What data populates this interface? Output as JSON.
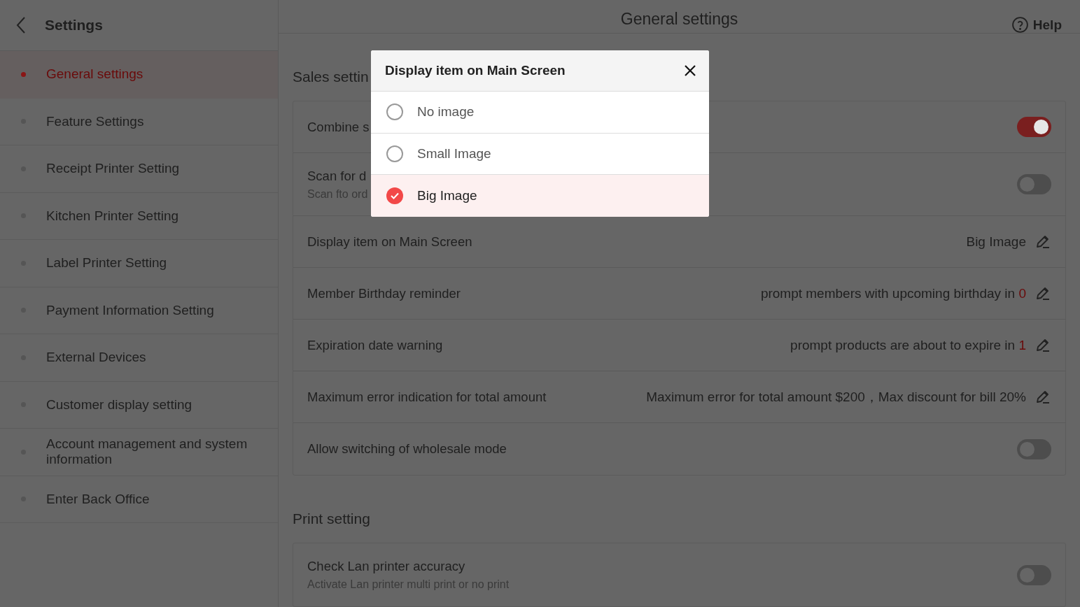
{
  "sidebar": {
    "title": "Settings",
    "items": [
      {
        "label": "General settings",
        "selected": true
      },
      {
        "label": "Feature Settings",
        "selected": false
      },
      {
        "label": "Receipt Printer Setting",
        "selected": false
      },
      {
        "label": "Kitchen Printer Setting",
        "selected": false
      },
      {
        "label": "Label Printer Setting",
        "selected": false
      },
      {
        "label": "Payment Information Setting",
        "selected": false
      },
      {
        "label": "External Devices",
        "selected": false
      },
      {
        "label": "Customer display setting",
        "selected": false
      },
      {
        "label": "Account management and system information",
        "selected": false
      },
      {
        "label": "Enter Back Office",
        "selected": false
      }
    ]
  },
  "header": {
    "title": "General settings",
    "help": "Help"
  },
  "sections": [
    {
      "title": "Sales settin",
      "rows": [
        {
          "kind": "toggle",
          "label": "Combine s",
          "on": true
        },
        {
          "kind": "toggle",
          "label": "Scan for d",
          "subtitle": "Scan fto ord",
          "on": false
        },
        {
          "kind": "value",
          "label": "Display item on Main Screen",
          "value": "Big Image"
        },
        {
          "kind": "value",
          "label": "Member Birthday reminder",
          "value": "prompt members with upcoming birthday in",
          "highlight": "0"
        },
        {
          "kind": "value",
          "label": "Expiration date warning",
          "value": "prompt products are about to expire in",
          "highlight": "1"
        },
        {
          "kind": "value",
          "label": "Maximum error indication for total amount",
          "value": "Maximum error for total amount $200，Max discount for bill 20%"
        },
        {
          "kind": "toggle",
          "label": "Allow switching of wholesale mode",
          "on": false
        }
      ]
    },
    {
      "title": "Print setting",
      "rows": [
        {
          "kind": "toggle",
          "label": "Check Lan printer accuracy",
          "subtitle": "Activate Lan printer multi print or no print",
          "on": false
        }
      ]
    }
  ],
  "dialog": {
    "title": "Display item on Main Screen",
    "options": [
      {
        "label": "No image",
        "selected": false
      },
      {
        "label": "Small Image",
        "selected": false
      },
      {
        "label": "Big Image",
        "selected": true
      }
    ]
  }
}
